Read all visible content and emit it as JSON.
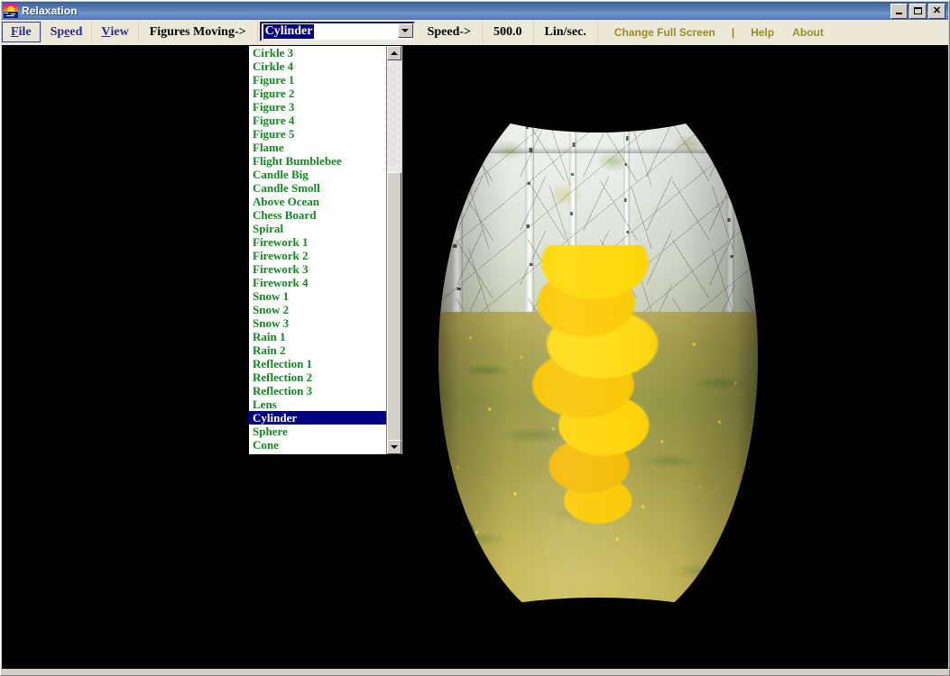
{
  "window": {
    "title": "Relaxation",
    "icon": "sunset-icon",
    "buttons": {
      "minimize": "minimize-button",
      "maximize": "maximize-button",
      "close": "close-button"
    }
  },
  "toolbar": {
    "menus": [
      {
        "label": "File",
        "accel": "F",
        "focused": true
      },
      {
        "label": "Speed",
        "accel": "e",
        "focused": false
      },
      {
        "label": "View",
        "accel": "V",
        "focused": false
      }
    ],
    "figures_label": "Figures Moving->",
    "speed_label": "Speed->",
    "speed_value": "500.0",
    "speed_unit": "Lin/sec.",
    "full_screen": "Change Full Screen",
    "separator": "|",
    "help": "Help",
    "about": "About",
    "accent_olive": "#9a8b28",
    "menu_blue": "#2b2b8f"
  },
  "combobox": {
    "value": "Cylinder",
    "expanded": true,
    "arrow_icon": "chevron-down-icon",
    "highlight_bg": "#000080",
    "highlight_fg": "#ffffff"
  },
  "dropdown": {
    "item_color": "#118822",
    "selected": "Cylinder",
    "items": [
      "Cirkle 3",
      "Cirkle 4",
      "Figure 1",
      "Figure 2",
      "Figure 3",
      "Figure 4",
      "Figure 5",
      "Flame",
      "Flight Bumblebee",
      "Candle Big",
      "Candle Smoll",
      "Above Ocean",
      "Chess Board",
      "Spiral",
      "Firework 1",
      "Firework 2",
      "Firework 3",
      "Firework 4",
      "Snow 1",
      "Snow 2",
      "Snow 3",
      "Rain 1",
      "Rain 2",
      "Reflection 1",
      "Reflection 2",
      "Reflection 3",
      "Lens",
      "Cylinder",
      "Sphere",
      "Cone"
    ],
    "scrollbar": {
      "up_icon": "scroll-up-arrow-icon",
      "down_icon": "scroll-down-arrow-icon"
    }
  },
  "canvas": {
    "background": "#000000",
    "figure": "Cylinder",
    "texture_description": "autumn birch forest with yellow maple foliage"
  }
}
